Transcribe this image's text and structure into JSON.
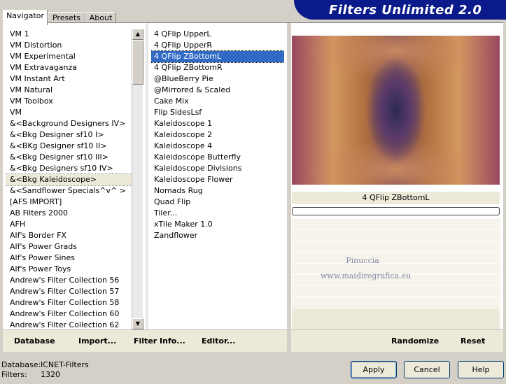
{
  "title": "Filters Unlimited 2.0",
  "tabs": [
    {
      "label": "Navigator",
      "active": true
    },
    {
      "label": "Presets",
      "active": false
    },
    {
      "label": "About",
      "active": false
    }
  ],
  "categories": [
    "VM 1",
    "VM Distortion",
    "VM Experimental",
    "VM Extravaganza",
    "VM Instant Art",
    "VM Natural",
    "VM Toolbox",
    "VM",
    "&<Background Designers IV>",
    "&<Bkg Designer sf10 I>",
    "&<BKg Designer sf10 II>",
    "&<Bkg Designer sf10 III>",
    "&<Bkg Designers sf10 IV>",
    "&<Bkg Kaleidoscope>",
    "&<Sandflower Specials^v^ >",
    "[AFS IMPORT]",
    "AB Filters 2000",
    "AFH",
    "Alf's Border FX",
    "Alf's Power Grads",
    "Alf's Power Sines",
    "Alf's Power Toys",
    "Andrew's Filter Collection 56",
    "Andrew's Filter Collection 57",
    "Andrew's Filter Collection 58",
    "Andrew's Filter Collection 60",
    "Andrew's Filter Collection 62"
  ],
  "selected_category_index": 13,
  "filters": [
    "4 QFlip UpperL",
    "4 QFlip UpperR",
    "4 QFlip ZBottomL",
    "4 QFlip ZBottomR",
    "@BlueBerry Pie",
    "@Mirrored & Scaled",
    "Cake Mix",
    "Flip SidesLsf",
    "Kaleidoscope 1",
    "Kaleidoscope 2",
    "Kaleidoscope 4",
    "Kaleidoscope Butterfly",
    "Kaleidoscope Divisions",
    "Kaleidoscope Flower",
    "Nomads Rug",
    "Quad Flip",
    "Tiler...",
    "xTile Maker 1.0",
    "Zandflower"
  ],
  "selected_filter_index": 2,
  "preview": {
    "filter_name": "4 QFlip ZBottomL",
    "watermark_line1": "Pinuccia",
    "watermark_line2": "www.maidiregrafica.eu"
  },
  "bottom_bar": {
    "database": "Database",
    "import": "Import...",
    "filter_info": "Filter Info...",
    "editor": "Editor...",
    "randomize": "Randomize",
    "reset": "Reset"
  },
  "status": {
    "database_label": "Database:",
    "database_value": "ICNET-Filters",
    "filters_label": "Filters:",
    "filters_value": "1320"
  },
  "buttons": {
    "apply": "Apply",
    "cancel": "Cancel",
    "help": "Help"
  }
}
